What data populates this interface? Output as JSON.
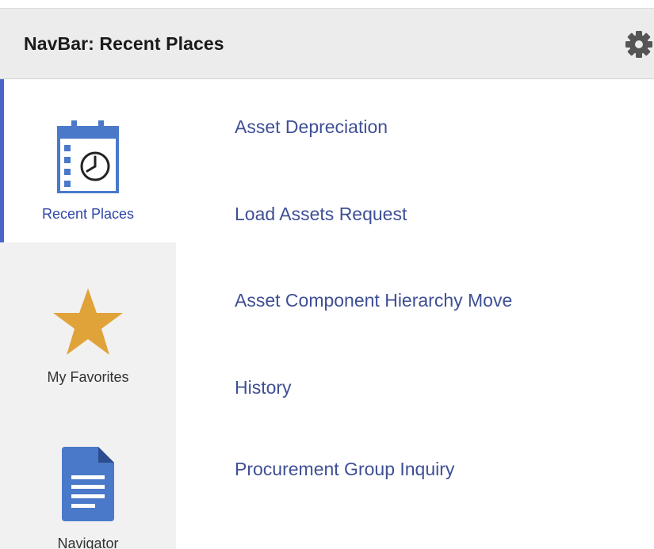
{
  "header": {
    "title": "NavBar: Recent Places",
    "settings_icon": "gear-icon"
  },
  "sidebar": {
    "items": [
      {
        "label": "Recent Places",
        "icon": "calendar-clock-icon",
        "active": true
      },
      {
        "label": "My Favorites",
        "icon": "star-icon",
        "active": false
      },
      {
        "label": "Navigator",
        "icon": "document-icon",
        "active": false
      }
    ]
  },
  "recent_places": {
    "links": [
      "Asset Depreciation",
      "Load Assets Request",
      "Asset Component Hierarchy Move",
      "History",
      "Procurement Group Inquiry"
    ]
  },
  "colors": {
    "active_accent": "#4a66c8",
    "link": "#3f4f95",
    "icon_blue": "#4a79c9",
    "star_gold": "#e0a33a",
    "header_bg": "#ececec",
    "sidebar_bg": "#f1f1f1"
  }
}
